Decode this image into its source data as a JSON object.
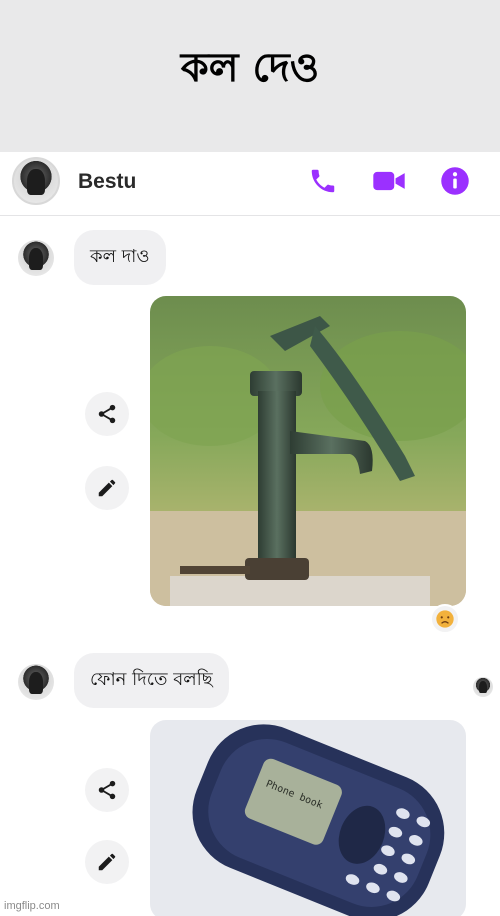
{
  "meme_caption": "কল দেও",
  "header": {
    "contact_name": "Bestu",
    "icons": [
      "phone-icon",
      "video-camera-icon",
      "info-icon"
    ],
    "accent_color": "#9b30ff"
  },
  "messages": [
    {
      "text": "কল দাও"
    },
    {
      "text": "ফোন দিতে বলছি"
    }
  ],
  "photos": [
    {
      "subject": "hand-pump",
      "reaction": "sad-face-emoji"
    },
    {
      "subject": "nokia-phone",
      "screen_text": "Phone book"
    }
  ],
  "message_action_icons": [
    "share-icon",
    "edit-pencil-icon"
  ],
  "watermark": "imgflip.com"
}
